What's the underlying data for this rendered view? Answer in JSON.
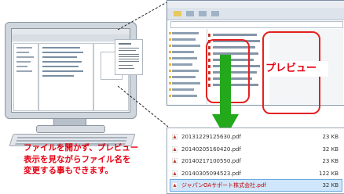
{
  "preview_callout": "プレビュー",
  "caption": {
    "line1": "ファイルを開かず、プレビュー",
    "line2": "表示を見ながらファイル名を",
    "line3": "変更する事もできます。"
  },
  "files": [
    {
      "name": "20131229125630.pdf",
      "size": "23 KB",
      "selected": false
    },
    {
      "name": "20140205160420.pdf",
      "size": "32 KB",
      "selected": false
    },
    {
      "name": "20140217100550.pdf",
      "size": "23 KB",
      "selected": false
    },
    {
      "name": "20140305094523.pdf",
      "size": "122 KB",
      "selected": false
    },
    {
      "name": "ジャパンOAサポート株式会社.pdf",
      "size": "32 KB",
      "selected": true
    }
  ],
  "colors": {
    "highlight_red": "#e62020",
    "caption_red": "#e60012",
    "arrow_green": "#24a81c",
    "pdf_icon_red": "#c0392b"
  },
  "icons": [
    "pdf-file-icon",
    "folder-icon",
    "down-arrow-icon"
  ]
}
